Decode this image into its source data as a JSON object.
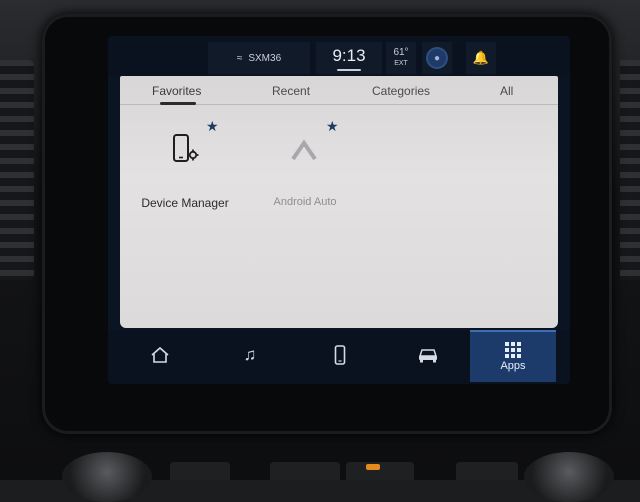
{
  "status_bar": {
    "radio_source": "SXM36",
    "time": "9:13",
    "temperature": "61°",
    "temperature_label": "EXT"
  },
  "tabs": [
    {
      "label": "Favorites",
      "active": true
    },
    {
      "label": "Recent",
      "active": false
    },
    {
      "label": "Categories",
      "active": false
    },
    {
      "label": "All",
      "active": false
    }
  ],
  "apps": [
    {
      "label": "Device Manager",
      "icon": "phone-settings-icon",
      "favorite": true,
      "enabled": true
    },
    {
      "label": "Android Auto",
      "icon": "android-auto-icon",
      "favorite": true,
      "enabled": false
    }
  ],
  "nav": {
    "home_icon": "home-icon",
    "media_icon": "music-note-icon",
    "phone_icon": "phone-icon",
    "vehicle_icon": "car-icon",
    "apps_label": "Apps"
  },
  "colors": {
    "accent": "#1c3b6b",
    "favorite_star": "#1f3b63",
    "panel": "#dedcdc"
  }
}
